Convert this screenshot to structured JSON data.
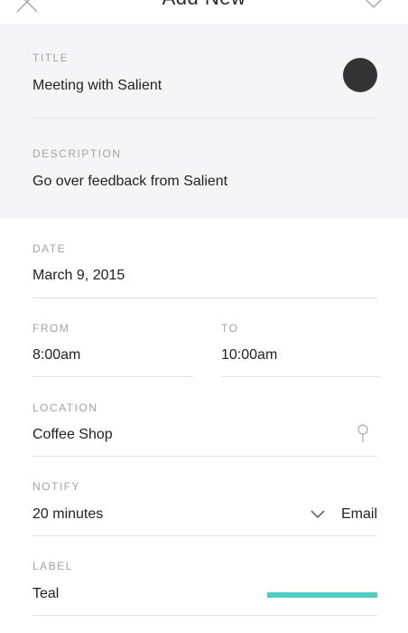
{
  "header": {
    "title": "Add New"
  },
  "form": {
    "title": {
      "label": "TITLE",
      "value": "Meeting with Salient",
      "color": "#333333"
    },
    "description": {
      "label": "DESCRIPTION",
      "value": "Go over feedback from Salient"
    },
    "date": {
      "label": "DATE",
      "value": "March 9, 2015"
    },
    "from": {
      "label": "FROM",
      "value": "8:00am"
    },
    "to": {
      "label": "TO",
      "value": "10:00am"
    },
    "location": {
      "label": "LOCATION",
      "value": "Coffee Shop",
      "icon": "location-pin-icon"
    },
    "notify": {
      "label": "NOTIFY",
      "value": "20 minutes",
      "method": "Email",
      "icon": "chevron-down-icon"
    },
    "label": {
      "label": "LABEL",
      "value": "Teal",
      "color": "#4ecdc4"
    }
  }
}
